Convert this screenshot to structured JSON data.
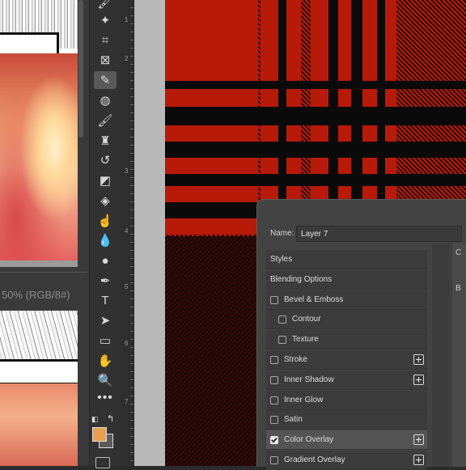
{
  "document": {
    "status_text": "50% (RGB/8#)"
  },
  "toolbar": {
    "tools": [
      {
        "name": "brush-smudge-icon",
        "glyph": "🖌"
      },
      {
        "name": "magic-wand-icon",
        "glyph": "✦"
      },
      {
        "name": "crop-icon",
        "glyph": "⌗"
      },
      {
        "name": "frame-icon",
        "glyph": "⊠"
      },
      {
        "name": "eyedropper-icon",
        "glyph": "✎"
      },
      {
        "name": "healing-brush-icon",
        "glyph": "◍"
      },
      {
        "name": "brush-icon",
        "glyph": "🖌"
      },
      {
        "name": "clone-stamp-icon",
        "glyph": "♜"
      },
      {
        "name": "history-brush-icon",
        "glyph": "↺"
      },
      {
        "name": "eraser-icon",
        "glyph": "◩"
      },
      {
        "name": "paint-bucket-icon",
        "glyph": "◈"
      },
      {
        "name": "smudge-icon",
        "glyph": "☝"
      },
      {
        "name": "blur-icon",
        "glyph": "💧"
      },
      {
        "name": "dodge-icon",
        "glyph": "●"
      },
      {
        "name": "pen-icon",
        "glyph": "✒"
      },
      {
        "name": "type-icon",
        "glyph": "T"
      },
      {
        "name": "path-selection-icon",
        "glyph": "➤"
      },
      {
        "name": "rectangle-icon",
        "glyph": "▭"
      },
      {
        "name": "hand-icon",
        "glyph": "✋"
      },
      {
        "name": "zoom-icon",
        "glyph": "🔍"
      }
    ],
    "more_label": "•••",
    "foreground_color": "#e8a050",
    "background_color": "#5a5a5a"
  },
  "ruler": {
    "numbers": [
      "1",
      "2",
      "3",
      "4",
      "5",
      "6",
      "7"
    ]
  },
  "canvas": {
    "pattern": "red-black-tartan",
    "colors": {
      "red": "#b81a0a",
      "black": "#0a0a0a",
      "dark_red": "#3a0806"
    }
  },
  "layer_style": {
    "name_label": "Name:",
    "name_value": "Layer 7",
    "right_panel_chars": [
      "C",
      "B"
    ],
    "rows": [
      {
        "label": "Styles",
        "type": "header"
      },
      {
        "label": "Blending Options",
        "type": "header"
      },
      {
        "label": "Bevel & Emboss",
        "type": "check",
        "checked": false,
        "indent": 0,
        "plus": false
      },
      {
        "label": "Contour",
        "type": "check",
        "checked": false,
        "indent": 1,
        "plus": false
      },
      {
        "label": "Texture",
        "type": "check",
        "checked": false,
        "indent": 1,
        "plus": false
      },
      {
        "label": "Stroke",
        "type": "check",
        "checked": false,
        "indent": 0,
        "plus": true
      },
      {
        "label": "Inner Shadow",
        "type": "check",
        "checked": false,
        "indent": 0,
        "plus": true
      },
      {
        "label": "Inner Glow",
        "type": "check",
        "checked": false,
        "indent": 0,
        "plus": false
      },
      {
        "label": "Satin",
        "type": "check",
        "checked": false,
        "indent": 0,
        "plus": false
      },
      {
        "label": "Color Overlay",
        "type": "check",
        "checked": true,
        "indent": 0,
        "plus": true,
        "selected": true
      },
      {
        "label": "Gradient Overlay",
        "type": "check",
        "checked": false,
        "indent": 0,
        "plus": true
      }
    ]
  }
}
